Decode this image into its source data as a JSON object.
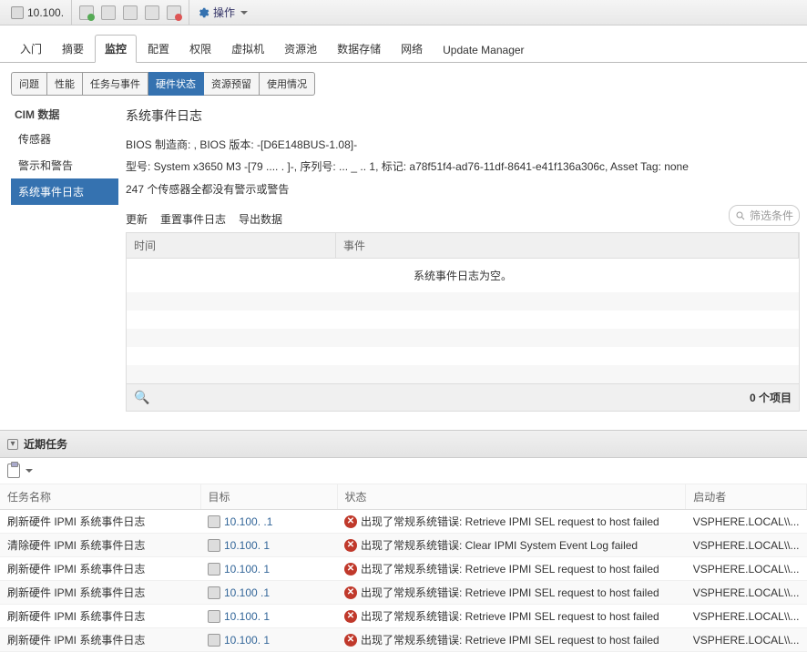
{
  "toolbar": {
    "ip": "10.100.",
    "action_label": "操作"
  },
  "mainTabs": [
    "入门",
    "摘要",
    "监控",
    "配置",
    "权限",
    "虚拟机",
    "资源池",
    "数据存储",
    "网络",
    "Update Manager"
  ],
  "mainTabActive": 2,
  "subTabs": [
    "问题",
    "性能",
    "任务与事件",
    "硬件状态",
    "资源预留",
    "使用情况"
  ],
  "subTabActive": 3,
  "sidebar": {
    "header": "CIM 数据",
    "items": [
      "传感器",
      "警示和警告",
      "系统事件日志"
    ],
    "active": 2
  },
  "pane": {
    "title": "系统事件日志",
    "info1": "BIOS 制造商: ,  BIOS 版本: -[D6E148BUS-1.08]-",
    "info2": "型号: System x3650 M3 -[79 .... . ]-,  序列号: ... _ .. 1,  标记: a78f51f4-ad76-11df-8641-e41f136a306c,  Asset Tag:  none",
    "info3": "247 个传感器全都没有警示或警告",
    "actions": [
      "更新",
      "重置事件日志",
      "导出数据"
    ],
    "filter_placeholder": "筛选条件",
    "columns": {
      "time": "时间",
      "event": "事件"
    },
    "empty_msg": "系统事件日志为空。",
    "footer_count": "0 个项目"
  },
  "tasksPanel": {
    "title": "近期任务",
    "columns": {
      "name": "任务名称",
      "target": "目标",
      "status": "状态",
      "initiator": "启动者"
    },
    "rows": [
      {
        "name": "刷新硬件 IPMI 系统事件日志",
        "target": "10.100. .1",
        "status": "出现了常规系统错误: Retrieve IPMI SEL request to host failed",
        "initiator": "VSPHERE.LOCAL\\\\..."
      },
      {
        "name": "清除硬件 IPMI 系统事件日志",
        "target": "10.100.  1",
        "status": "出现了常规系统错误: Clear IPMI System Event Log failed",
        "initiator": "VSPHERE.LOCAL\\\\..."
      },
      {
        "name": "刷新硬件 IPMI 系统事件日志",
        "target": "10.100.  1",
        "status": "出现了常规系统错误: Retrieve IPMI SEL request to host failed",
        "initiator": "VSPHERE.LOCAL\\\\..."
      },
      {
        "name": "刷新硬件 IPMI 系统事件日志",
        "target": "10.100 .1",
        "status": "出现了常规系统错误: Retrieve IPMI SEL request to host failed",
        "initiator": "VSPHERE.LOCAL\\\\..."
      },
      {
        "name": "刷新硬件 IPMI 系统事件日志",
        "target": "10.100.  1",
        "status": "出现了常规系统错误: Retrieve IPMI SEL request to host failed",
        "initiator": "VSPHERE.LOCAL\\\\..."
      },
      {
        "name": "刷新硬件 IPMI 系统事件日志",
        "target": "10.100.  1",
        "status": "出现了常规系统错误: Retrieve IPMI SEL request to host failed",
        "initiator": "VSPHERE.LOCAL\\\\..."
      }
    ]
  }
}
